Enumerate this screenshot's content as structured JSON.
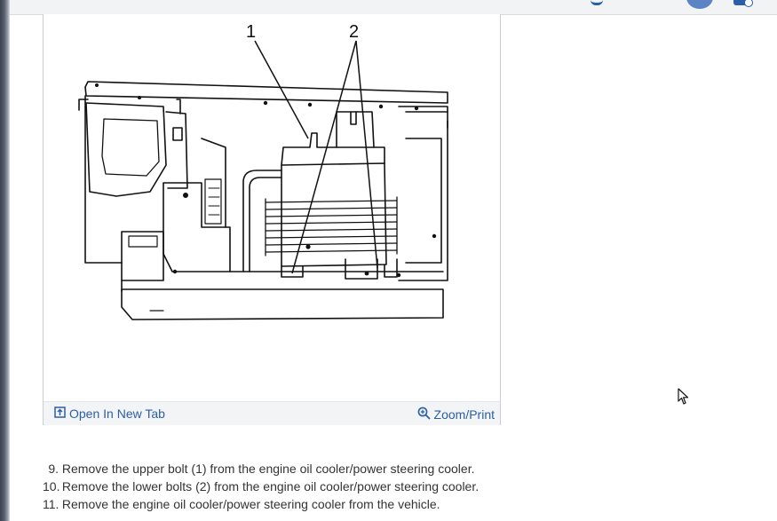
{
  "figure": {
    "callout_labels": [
      "1",
      "2"
    ],
    "open_tab_label": "Open In New Tab",
    "zoom_label": "Zoom/Print"
  },
  "steps": [
    {
      "number": "9.",
      "text": " Remove the upper bolt (1) from the engine oil cooler/power steering cooler."
    },
    {
      "number": "10.",
      "text": " Remove the lower bolts (2) from the engine oil cooler/power steering cooler."
    },
    {
      "number": "11.",
      "text": " Remove the engine oil cooler/power steering cooler from the vehicle."
    }
  ],
  "colors": {
    "link": "#2a5ea8",
    "avatar": "#5b84c4",
    "diagram_stroke": "#111111"
  },
  "icons": [
    "open-new-tab-icon",
    "zoom-icon",
    "avatar",
    "notification-icon",
    "add-icon",
    "mouse-cursor-icon"
  ]
}
